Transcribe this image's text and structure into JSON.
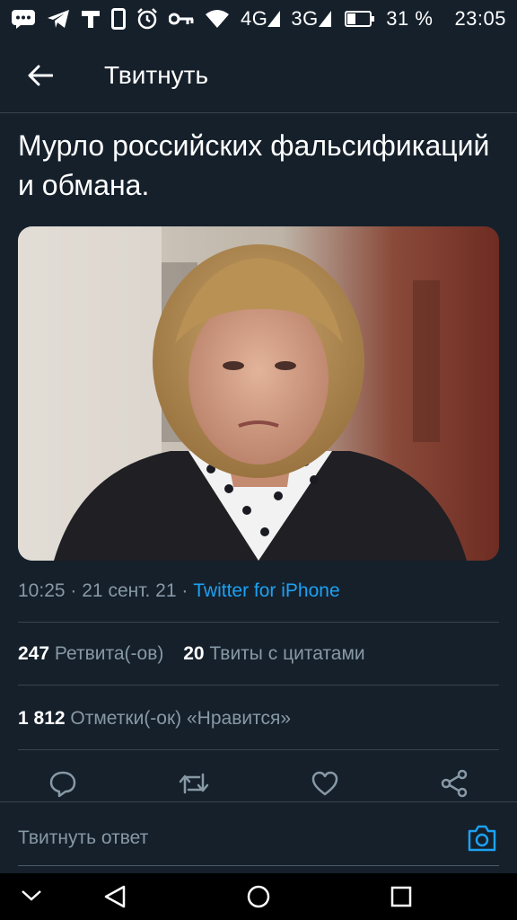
{
  "status_bar": {
    "network_1": "4G",
    "network_2": "3G",
    "battery": "31 %",
    "time": "23:05"
  },
  "header": {
    "title": "Твитнуть"
  },
  "tweet": {
    "text": "Мурло российских фальсификаций и обмана.",
    "time": "10:25",
    "separator": "·",
    "date": "21 сент. 21",
    "client": "Twitter for iPhone",
    "retweets_count": "247",
    "retweets_label": "Ретвита(-ов)",
    "quotes_count": "20",
    "quotes_label": "Твиты с цитатами",
    "likes_count": "1 812",
    "likes_label": "Отметки(-ок) «Нравится»"
  },
  "reply": {
    "placeholder": "Твитнуть ответ"
  },
  "colors": {
    "background": "#15202b",
    "accent": "#1da1f2",
    "secondary_text": "#8899a6",
    "divider": "#38444d"
  }
}
